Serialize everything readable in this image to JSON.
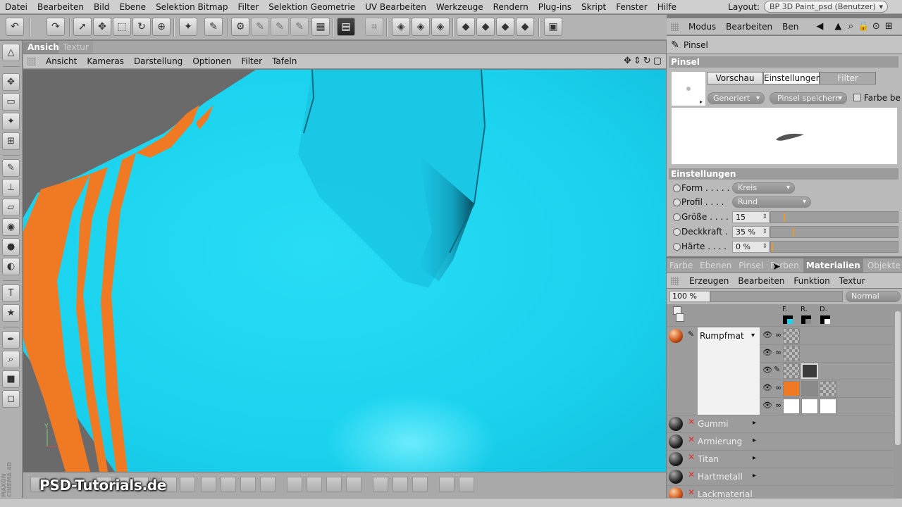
{
  "menubar": {
    "items": [
      "Datei",
      "Bearbeiten",
      "Bild",
      "Ebene",
      "Selektion Bitmap",
      "Filter",
      "Selektion Geometrie",
      "UV Bearbeiten",
      "Werkzeuge",
      "Rendern",
      "Plug-ins",
      "Skript",
      "Fenster",
      "Hilfe"
    ],
    "layout_label": "Layout:",
    "layout_value": "BP 3D Paint_psd (Benutzer)"
  },
  "viewport": {
    "tabs": [
      {
        "label": "Ansicht",
        "active": true
      },
      {
        "label": "Textur",
        "active": false
      }
    ],
    "menu": [
      "Ansicht",
      "Kameras",
      "Darstellung",
      "Optionen",
      "Filter",
      "Tafeln"
    ],
    "axis_label": "Y",
    "model_colors": {
      "body": "#1ad4ef",
      "stripe": "#f07a24",
      "background": "#6a6a6a"
    }
  },
  "watermark": "PSD-Tutorials.de",
  "right_panel": {
    "top_menu": [
      "Modus",
      "Bearbeiten",
      "Ben"
    ],
    "header_title": "Pinsel",
    "pinsel_section": "Pinsel",
    "preview_tabs": [
      "Vorschau",
      "Einstellungen",
      "Filter"
    ],
    "generiert": "Generiert",
    "save_brush": "Pinsel speichern",
    "farbe_checkbox": "Farbe be",
    "settings_section": "Einstellungen",
    "settings": [
      {
        "label": "Form . . . . .",
        "value": "Kreis",
        "kind": "dropdown"
      },
      {
        "label": "Profil . . . .",
        "value": "Rund",
        "kind": "dropdown"
      },
      {
        "label": "Größe . . . .",
        "value": "15",
        "kind": "slider",
        "level": 0.2
      },
      {
        "label": "Deckkraft .",
        "value": "35 %",
        "kind": "slider",
        "level": 0.35
      },
      {
        "label": "Härte . . . .",
        "value": "0 %",
        "kind": "slider",
        "level": 0.0
      }
    ],
    "tabs": [
      {
        "label": "Farbe",
        "active": false
      },
      {
        "label": "Ebenen",
        "active": false
      },
      {
        "label": "Pinsel",
        "active": false
      },
      {
        "label": "Farben",
        "active": false
      },
      {
        "label": "Materialien",
        "active": true
      },
      {
        "label": "Objekte",
        "active": false
      }
    ],
    "material_menu": [
      "Erzeugen",
      "Bearbeiten",
      "Funktion",
      "Textur"
    ],
    "zoom": "100 %",
    "blend_mode": "Normal",
    "channel_headers": [
      "F.",
      "R.",
      "D."
    ],
    "materials": [
      {
        "name": "Rumpfmat",
        "expanded": true
      },
      {
        "name": "Gummi",
        "expanded": false
      },
      {
        "name": "Armierung",
        "expanded": false
      },
      {
        "name": "Titan",
        "expanded": false
      },
      {
        "name": "Hartmetall",
        "expanded": false
      },
      {
        "name": "Lackmaterial",
        "expanded": false
      }
    ]
  }
}
